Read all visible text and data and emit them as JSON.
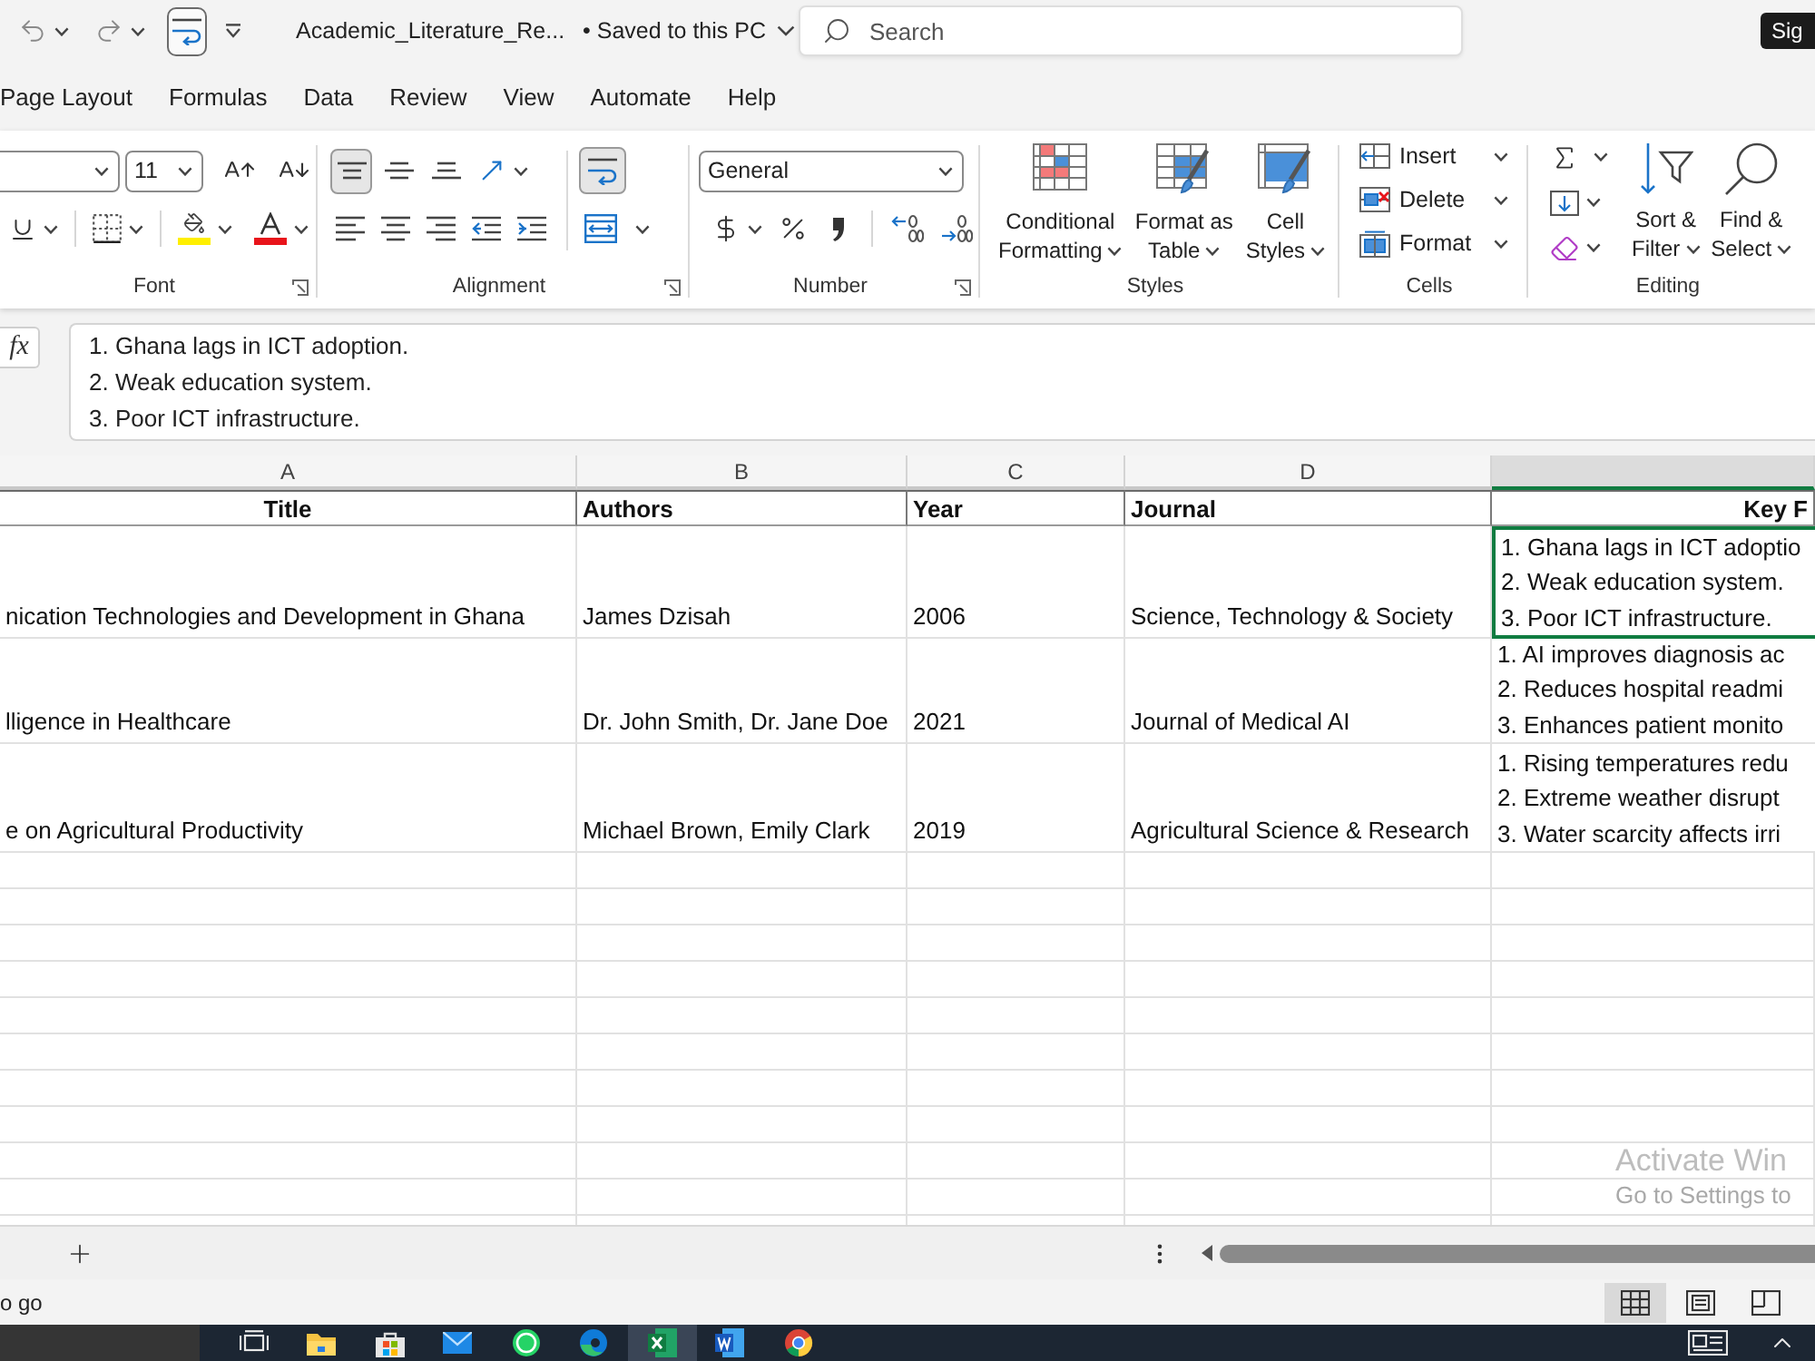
{
  "title_bar": {
    "file_name": "Academic_Literature_Re...",
    "save_status": "• Saved to this PC",
    "search": {
      "placeholder": "Search"
    },
    "account_button": "Sig"
  },
  "ribbon_tabs": [
    {
      "label": "Page Layout",
      "selected": false
    },
    {
      "label": "Formulas",
      "selected": false
    },
    {
      "label": "Data",
      "selected": false
    },
    {
      "label": "Review",
      "selected": false
    },
    {
      "label": "View",
      "selected": false
    },
    {
      "label": "Automate",
      "selected": false
    },
    {
      "label": "Help",
      "selected": false
    }
  ],
  "ribbon": {
    "font": {
      "label": "Font",
      "size": "11"
    },
    "alignment": {
      "label": "Alignment",
      "vertical": [
        {
          "kind": "top",
          "selected": true
        },
        {
          "kind": "middle",
          "selected": false
        },
        {
          "kind": "bottom",
          "selected": false
        }
      ],
      "wrap_text": {
        "on": true
      }
    },
    "number": {
      "label": "Number",
      "format": "General"
    },
    "styles": {
      "label": "Styles",
      "buttons": [
        {
          "kind": "conditional",
          "lines": [
            "Conditional",
            "Formatting"
          ]
        },
        {
          "kind": "table",
          "lines": [
            "Format as",
            "Table"
          ]
        },
        {
          "kind": "cell",
          "lines": [
            "Cell",
            "Styles"
          ]
        }
      ]
    },
    "cells": {
      "label": "Cells",
      "buttons": [
        {
          "kind": "insert",
          "label": "Insert"
        },
        {
          "kind": "delete",
          "label": "Delete"
        },
        {
          "kind": "format",
          "label": "Format"
        }
      ]
    },
    "editing": {
      "label": "Editing",
      "buttons": [
        {
          "kind": "sort",
          "lines": [
            "Sort &",
            "Filter"
          ]
        },
        {
          "kind": "find",
          "lines": [
            "Find &",
            "Select"
          ]
        }
      ]
    }
  },
  "formula_bar": {
    "function_button": "fx",
    "lines": [
      "1. Ghana lags in ICT adoption.",
      "2. Weak education system.",
      "3. Poor ICT infrastructure."
    ]
  },
  "sheet": {
    "columns": [
      {
        "letter": "A",
        "selected": false
      },
      {
        "letter": "B",
        "selected": false
      },
      {
        "letter": "C",
        "selected": false
      },
      {
        "letter": "D",
        "selected": false
      },
      {
        "selected": true
      }
    ],
    "header_row": [
      "Title",
      "Authors",
      "Year",
      "Journal",
      "Key F"
    ],
    "rows": [
      {
        "cells": [
          "nication Technologies and Development in Ghana",
          "James Dzisah",
          "2006",
          "Science, Technology & Society"
        ],
        "findings": {
          "lines": [
            "1. Ghana lags in ICT adoptio",
            "2. Weak education system.",
            "3. Poor ICT infrastructure."
          ],
          "selected": true
        }
      },
      {
        "cells": [
          "lligence in Healthcare",
          "Dr. John Smith, Dr. Jane Doe",
          "2021",
          "Journal of Medical AI"
        ],
        "findings": {
          "lines": [
            "1. AI improves diagnosis ac",
            "2. Reduces hospital readmi",
            "3. Enhances patient monito"
          ],
          "selected": false
        }
      },
      {
        "cells": [
          "e on Agricultural Productivity",
          "Michael Brown, Emily Clark",
          "2019",
          "Agricultural Science & Research"
        ],
        "findings": {
          "lines": [
            "1. Rising temperatures redu",
            "2. Extreme weather disrupt",
            "3. Water scarcity affects irri"
          ],
          "selected": false
        }
      }
    ]
  },
  "activation_notice": {
    "title": "Activate Win",
    "hint": "Go to Settings to"
  },
  "status_bar": {
    "message": "o go",
    "views": [
      {
        "kind": "normal",
        "selected": true
      },
      {
        "kind": "page_layout",
        "selected": false
      },
      {
        "kind": "page_break",
        "selected": false
      }
    ]
  },
  "taskbar": {
    "apps": [
      {
        "kind": "task_view",
        "active": false
      },
      {
        "kind": "folder",
        "active": false
      },
      {
        "kind": "store",
        "active": false
      },
      {
        "kind": "mail",
        "active": false
      },
      {
        "kind": "chat",
        "active": false
      },
      {
        "kind": "browser",
        "active": false
      },
      {
        "kind": "spreadsheet",
        "active": true
      },
      {
        "kind": "document",
        "active": false
      },
      {
        "kind": "browser_circle",
        "active": false
      }
    ]
  }
}
